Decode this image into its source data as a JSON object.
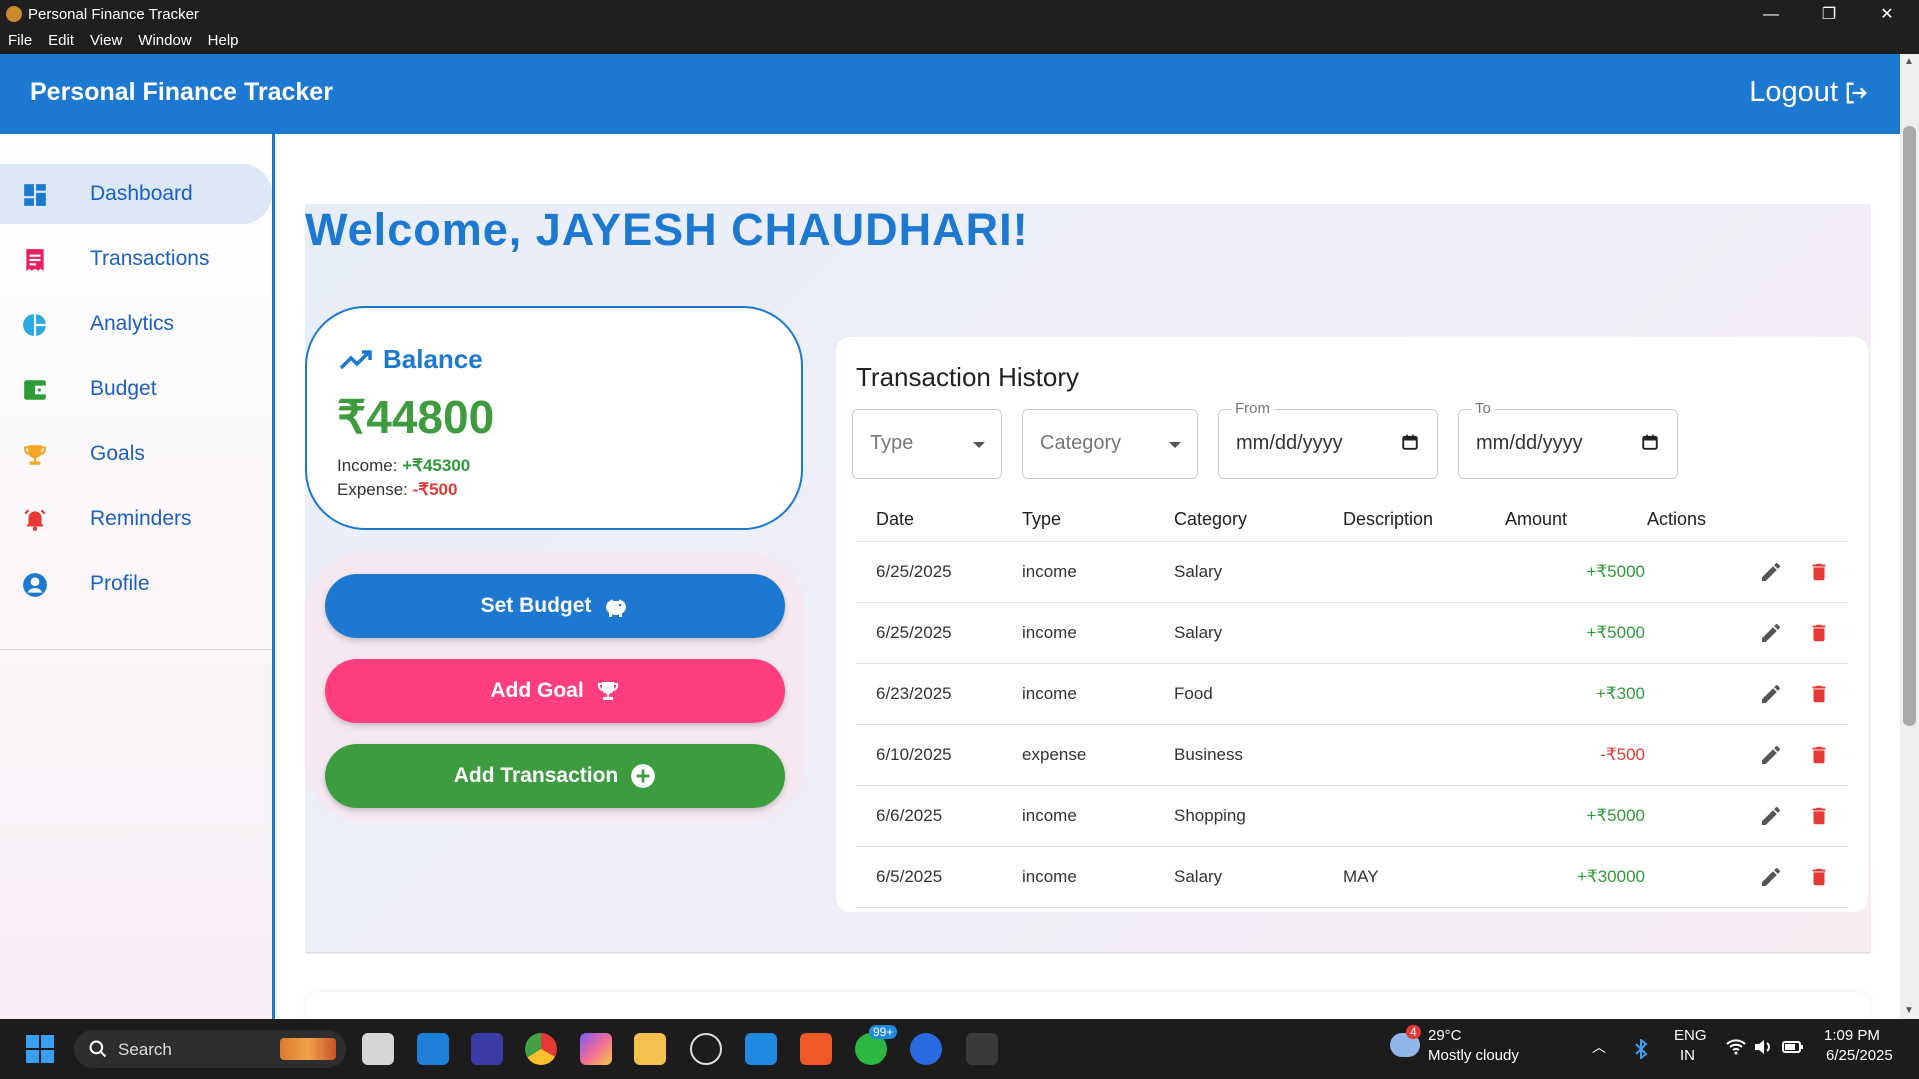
{
  "window": {
    "title": "Personal Finance Tracker",
    "menu": [
      "File",
      "Edit",
      "View",
      "Window",
      "Help"
    ],
    "controls": {
      "minimize": "—",
      "restore": "❐",
      "close": "✕"
    }
  },
  "header": {
    "brand": "Personal Finance Tracker",
    "logout_label": "Logout"
  },
  "sidebar": {
    "items": [
      {
        "label": "Dashboard",
        "icon": "dashboard-icon",
        "color": "#1c78d1"
      },
      {
        "label": "Transactions",
        "icon": "receipt-icon",
        "color": "#e91e63"
      },
      {
        "label": "Analytics",
        "icon": "pie-chart-icon",
        "color": "#29a9e1"
      },
      {
        "label": "Budget",
        "icon": "wallet-icon",
        "color": "#2e9b3a"
      },
      {
        "label": "Goals",
        "icon": "trophy-icon",
        "color": "#f5a623"
      },
      {
        "label": "Reminders",
        "icon": "alarm-icon",
        "color": "#e53935"
      },
      {
        "label": "Profile",
        "icon": "account-icon",
        "color": "#1c78d1"
      }
    ]
  },
  "dashboard": {
    "welcome": "Welcome, JAYESH CHAUDHARI!",
    "balance": {
      "title": "Balance",
      "amount": "₹44800",
      "income_label": "Income:",
      "income_value": "+₹45300",
      "expense_label": "Expense:",
      "expense_value": "-₹500"
    },
    "actions": {
      "set_budget": "Set Budget",
      "add_goal": "Add Goal",
      "add_transaction": "Add Transaction"
    }
  },
  "history": {
    "title": "Transaction History",
    "filters": {
      "type_placeholder": "Type",
      "category_placeholder": "Category",
      "from_label": "From",
      "from_value": "mm/dd/yyyy",
      "to_label": "To",
      "to_value": "mm/dd/yyyy"
    },
    "columns": [
      "Date",
      "Type",
      "Category",
      "Description",
      "Amount",
      "Actions"
    ],
    "rows": [
      {
        "date": "6/25/2025",
        "type": "income",
        "category": "Salary",
        "description": "",
        "amount": "+₹5000"
      },
      {
        "date": "6/25/2025",
        "type": "income",
        "category": "Salary",
        "description": "",
        "amount": "+₹5000"
      },
      {
        "date": "6/23/2025",
        "type": "income",
        "category": "Food",
        "description": "",
        "amount": "+₹300"
      },
      {
        "date": "6/10/2025",
        "type": "expense",
        "category": "Business",
        "description": "",
        "amount": "-₹500"
      },
      {
        "date": "6/6/2025",
        "type": "income",
        "category": "Shopping",
        "description": "",
        "amount": "+₹5000"
      },
      {
        "date": "6/5/2025",
        "type": "income",
        "category": "Salary",
        "description": "MAY",
        "amount": "+₹30000"
      }
    ]
  },
  "taskbar": {
    "search_placeholder": "Search",
    "whatsapp_badge": "99+",
    "weather_badge": "4",
    "weather_temp": "29°C",
    "weather_desc": "Mostly cloudy",
    "lang_line1": "ENG",
    "lang_line2": "IN",
    "time": "1:09 PM",
    "date": "6/25/2025"
  },
  "colors": {
    "primary": "#1c78d1",
    "set_budget": "#1c78d1",
    "add_goal": "#ff3d7f",
    "add_transaction": "#3c9c3f",
    "positive": "#2e9b3a",
    "negative": "#e53935"
  }
}
